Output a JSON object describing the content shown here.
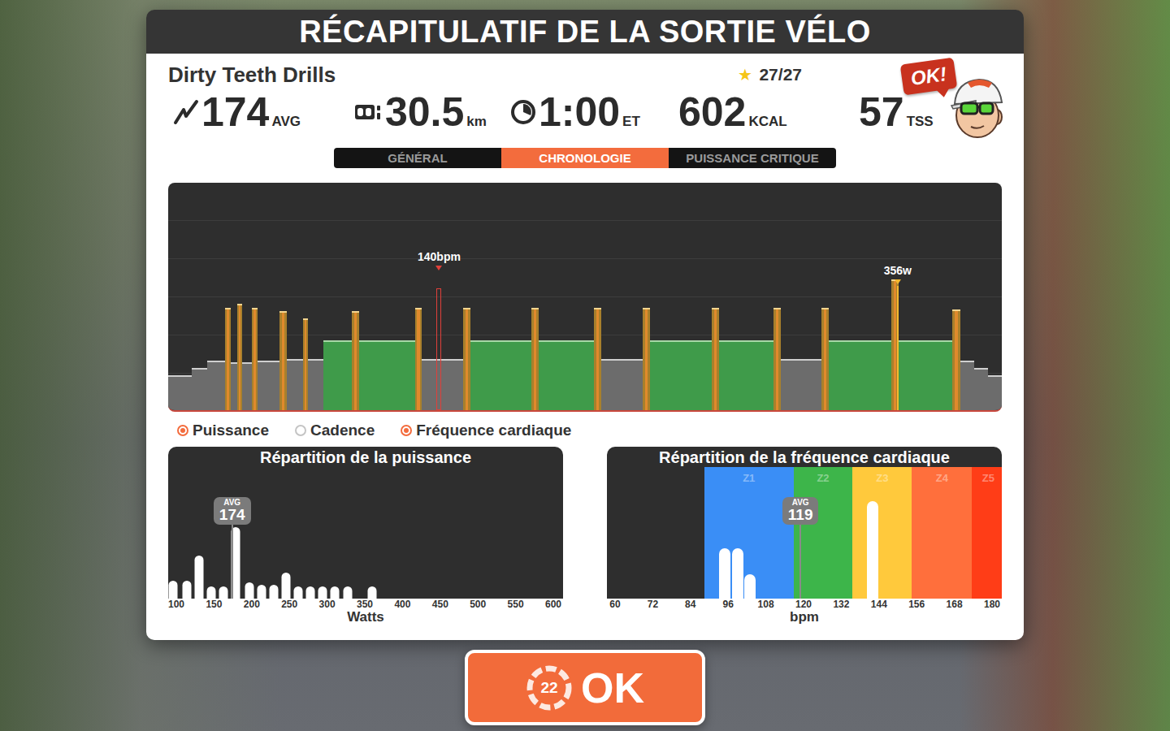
{
  "screen": {
    "title": "RÉCAPITULATIF DE LA SORTIE VÉLO"
  },
  "workout": {
    "name": "Dirty Teeth Drills",
    "star": "★",
    "progress": "27/27"
  },
  "stats": [
    {
      "kind": "power",
      "value": "174",
      "unit": "AVG"
    },
    {
      "kind": "distance",
      "value": "30.5",
      "unit": "km"
    },
    {
      "kind": "time",
      "value": "1:00",
      "unit": "ET"
    },
    {
      "kind": "calories",
      "value": "602",
      "unit": "KCAL"
    },
    {
      "kind": "tss",
      "value": "57",
      "unit": "TSS"
    }
  ],
  "coach": {
    "bubble": "OK!"
  },
  "tabs": [
    {
      "label": "GÉNÉRAL",
      "selected": false
    },
    {
      "label": "CHRONOLOGIE",
      "selected": true
    },
    {
      "label": "PUISSANCE CRITIQUE",
      "selected": false
    }
  ],
  "timeline": {
    "blocks": [
      {
        "kind": "warmup",
        "watts": 95,
        "seconds": 100
      },
      {
        "kind": "warmup",
        "watts": 115,
        "seconds": 70
      },
      {
        "kind": "warmup",
        "watts": 135,
        "seconds": 74
      },
      {
        "kind": "sprint",
        "watts": 280,
        "seconds": 25
      },
      {
        "kind": "rest",
        "watts": 130,
        "seconds": 28
      },
      {
        "kind": "sprint",
        "watts": 290,
        "seconds": 21
      },
      {
        "kind": "rest",
        "watts": 130,
        "seconds": 42
      },
      {
        "kind": "sprint",
        "watts": 280,
        "seconds": 25
      },
      {
        "kind": "rest",
        "watts": 135,
        "seconds": 95
      },
      {
        "kind": "sprint",
        "watts": 270,
        "seconds": 32
      },
      {
        "kind": "rest",
        "watts": 140,
        "seconds": 70
      },
      {
        "kind": "sprint",
        "watts": 250,
        "seconds": 21
      },
      {
        "kind": "rest",
        "watts": 140,
        "seconds": 67
      },
      {
        "kind": "interval",
        "watts": 190,
        "seconds": 123
      },
      {
        "kind": "sprint",
        "watts": 270,
        "seconds": 32
      },
      {
        "kind": "interval",
        "watts": 190,
        "seconds": 242
      },
      {
        "kind": "sprint",
        "watts": 280,
        "seconds": 28
      },
      {
        "kind": "rest",
        "watts": 140,
        "seconds": 179
      },
      {
        "kind": "sprint",
        "watts": 280,
        "seconds": 32
      },
      {
        "kind": "interval",
        "watts": 190,
        "seconds": 263
      },
      {
        "kind": "sprint",
        "watts": 280,
        "seconds": 32
      },
      {
        "kind": "interval",
        "watts": 190,
        "seconds": 239
      },
      {
        "kind": "sprint",
        "watts": 280,
        "seconds": 32
      },
      {
        "kind": "rest",
        "watts": 140,
        "seconds": 176
      },
      {
        "kind": "sprint",
        "watts": 280,
        "seconds": 32
      },
      {
        "kind": "interval",
        "watts": 190,
        "seconds": 267
      },
      {
        "kind": "sprint",
        "watts": 280,
        "seconds": 32
      },
      {
        "kind": "interval",
        "watts": 190,
        "seconds": 235
      },
      {
        "kind": "sprint",
        "watts": 280,
        "seconds": 32
      },
      {
        "kind": "rest",
        "watts": 140,
        "seconds": 176
      },
      {
        "kind": "sprint",
        "watts": 280,
        "seconds": 32
      },
      {
        "kind": "interval",
        "watts": 190,
        "seconds": 270
      },
      {
        "kind": "sprint",
        "watts": 356,
        "seconds": 32
      },
      {
        "kind": "interval",
        "watts": 190,
        "seconds": 232
      },
      {
        "kind": "sprint",
        "watts": 275,
        "seconds": 35
      },
      {
        "kind": "cooldown",
        "watts": 135,
        "seconds": 60
      },
      {
        "kind": "cooldown",
        "watts": 115,
        "seconds": 60
      },
      {
        "kind": "cooldown",
        "watts": 95,
        "seconds": 57
      }
    ],
    "markers": [
      {
        "label": "140bpm",
        "kind": "hr",
        "second": 1170,
        "value": 140
      },
      {
        "label": "356w",
        "kind": "power",
        "second": 3150,
        "value": 356
      }
    ]
  },
  "legend": [
    {
      "label": "Puissance",
      "selected": true
    },
    {
      "label": "Cadence",
      "selected": false
    },
    {
      "label": "Fréquence cardiaque",
      "selected": true
    }
  ],
  "power_distribution": {
    "title": "Répartition de la puissance",
    "avg_label": "AVG",
    "avg": "174",
    "ticks": [
      "100",
      "150",
      "200",
      "250",
      "300",
      "350",
      "400",
      "450",
      "500",
      "550",
      "600"
    ],
    "axis_title": "Watts",
    "bars": [
      {
        "watts": 96,
        "minutes": 3.4
      },
      {
        "watts": 114,
        "minutes": 3.4
      },
      {
        "watts": 130,
        "minutes": 8
      },
      {
        "watts": 146,
        "minutes": 2.3
      },
      {
        "watts": 163,
        "minutes": 2.3
      },
      {
        "watts": 179,
        "minutes": 13.4
      },
      {
        "watts": 197,
        "minutes": 3.1
      },
      {
        "watts": 213,
        "minutes": 2.6
      },
      {
        "watts": 229,
        "minutes": 2.6
      },
      {
        "watts": 245,
        "minutes": 4.9
      },
      {
        "watts": 262,
        "minutes": 2.3
      },
      {
        "watts": 278,
        "minutes": 2.3
      },
      {
        "watts": 294,
        "minutes": 2.3
      },
      {
        "watts": 310,
        "minutes": 2.3
      },
      {
        "watts": 327,
        "minutes": 2.3
      },
      {
        "watts": 360,
        "minutes": 2.3
      }
    ]
  },
  "hr_distribution": {
    "title": "Répartition de la fréquence cardiaque",
    "avg_label": "AVG",
    "avg": "119",
    "ticks": [
      "60",
      "72",
      "84",
      "96",
      "108",
      "120",
      "132",
      "144",
      "156",
      "168",
      "180"
    ],
    "axis_title": "bpm",
    "zones": [
      {
        "label": "Z1",
        "from": 88.4,
        "to": 116.8,
        "color": "#3a8ef6"
      },
      {
        "label": "Z2",
        "from": 116.8,
        "to": 135.6,
        "color": "#3db54a"
      },
      {
        "label": "Z3",
        "from": 135.6,
        "to": 154.5,
        "color": "#ffc93c"
      },
      {
        "label": "Z4",
        "from": 154.5,
        "to": 173.6,
        "color": "#ff6f3c"
      },
      {
        "label": "Z5",
        "from": 173.6,
        "to": 184,
        "color": "#ff3d17"
      }
    ],
    "bars": [
      {
        "bpm": 95,
        "minutes": 13.6
      },
      {
        "bpm": 99,
        "minutes": 13.6
      },
      {
        "bpm": 103,
        "minutes": 6.6
      },
      {
        "bpm": 142,
        "minutes": 26.3
      }
    ]
  },
  "ok_button": {
    "badge": "22",
    "label": "OK"
  }
}
